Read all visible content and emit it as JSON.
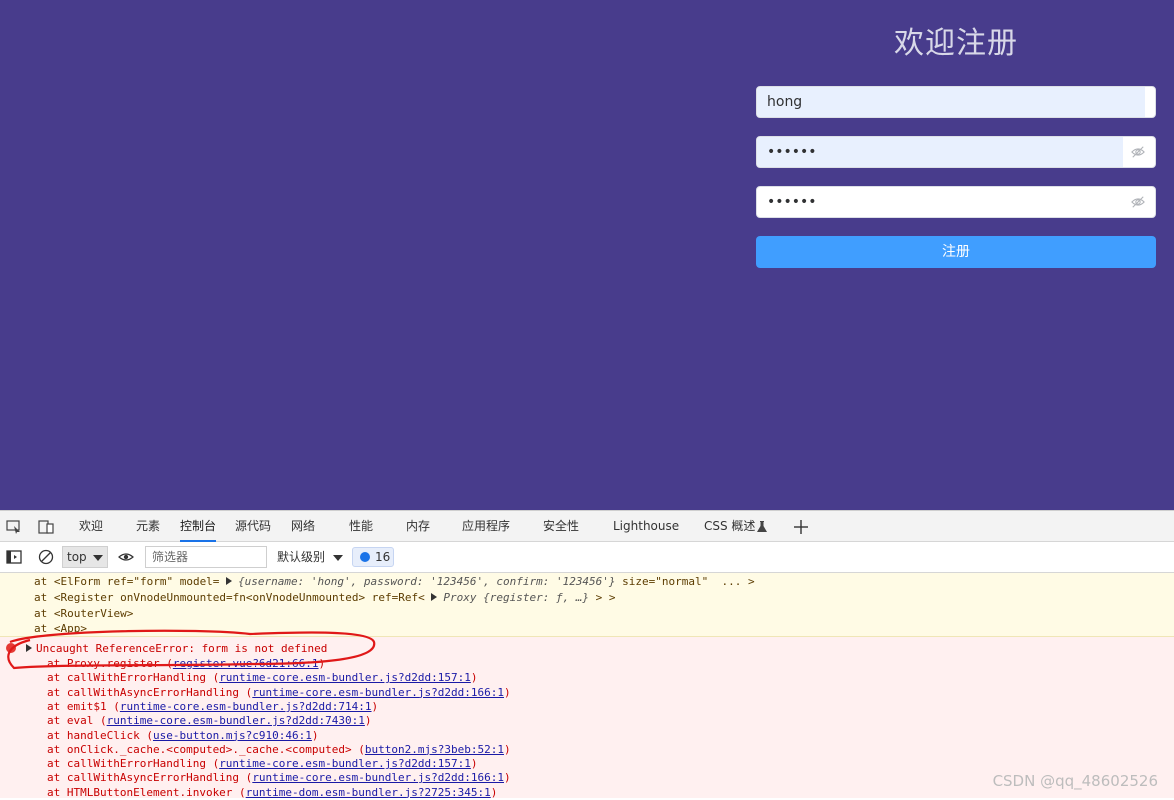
{
  "page": {
    "title": "欢迎注册",
    "username_value": "hong",
    "password_value": "••••••",
    "confirm_value": "••••••",
    "submit_label": "注册",
    "colors": {
      "background": "#483c8c",
      "button": "#409eff"
    }
  },
  "devtools": {
    "tabs": [
      "欢迎",
      "元素",
      "控制台",
      "源代码",
      "网络",
      "性能",
      "内存",
      "应用程序",
      "安全性",
      "Lighthouse",
      "CSS 概述"
    ],
    "active_tab": "控制台",
    "context": "top",
    "filter_placeholder": "筛选器",
    "level_label": "默认级别",
    "issue_count": "16",
    "warn_lines": {
      "l1_prefix": "at <ElForm ref=\"form\" model= ",
      "l1_obj": "{username: 'hong', password: '123456', confirm: '123456'}",
      "l1_suffix": " size=\"normal\"  ... >",
      "l2_prefix": "at <Register onVnodeUnmounted=fn<onVnodeUnmounted> ref=Ref< ",
      "l2_obj": "Proxy {register: ƒ, …}",
      "l2_suffix": " > >",
      "l3": "at <RouterView>",
      "l4": "at <App>"
    },
    "error": {
      "message": "Uncaught ReferenceError: form is not defined",
      "frames": [
        {
          "fn": "at Proxy.register (",
          "loc": "register.vue?6d21:66:1",
          "end": ")"
        },
        {
          "fn": "at callWithErrorHandling (",
          "loc": "runtime-core.esm-bundler.js?d2dd:157:1",
          "end": ")"
        },
        {
          "fn": "at callWithAsyncErrorHandling (",
          "loc": "runtime-core.esm-bundler.js?d2dd:166:1",
          "end": ")"
        },
        {
          "fn": "at emit$1 (",
          "loc": "runtime-core.esm-bundler.js?d2dd:714:1",
          "end": ")"
        },
        {
          "fn": "at eval (",
          "loc": "runtime-core.esm-bundler.js?d2dd:7430:1",
          "end": ")"
        },
        {
          "fn": "at handleClick (",
          "loc": "use-button.mjs?c910:46:1",
          "end": ")"
        },
        {
          "fn": "at onClick._cache.<computed>._cache.<computed> (",
          "loc": "button2.mjs?3beb:52:1",
          "end": ")"
        },
        {
          "fn": "at callWithErrorHandling (",
          "loc": "runtime-core.esm-bundler.js?d2dd:157:1",
          "end": ")"
        },
        {
          "fn": "at callWithAsyncErrorHandling (",
          "loc": "runtime-core.esm-bundler.js?d2dd:166:1",
          "end": ")"
        },
        {
          "fn": "at HTMLButtonElement.invoker (",
          "loc": "runtime-dom.esm-bundler.js?2725:345:1",
          "end": ")"
        }
      ]
    }
  },
  "watermark": "CSDN @qq_48602526"
}
